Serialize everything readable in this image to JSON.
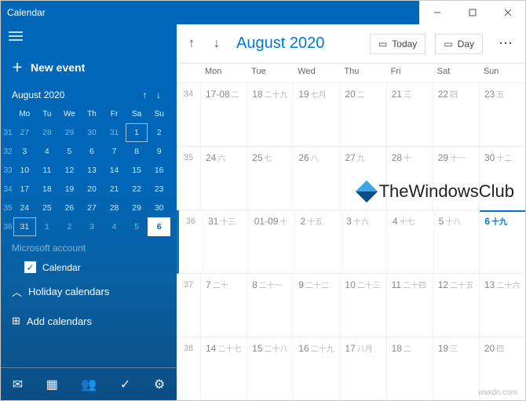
{
  "titlebar": {
    "title": "Calendar"
  },
  "sidebar": {
    "new_event": "New event",
    "mini_title": "August 2020",
    "dow": [
      "Mo",
      "Tu",
      "We",
      "Th",
      "Fr",
      "Sa",
      "Su"
    ],
    "weeks": [
      {
        "num": "31",
        "days": [
          {
            "t": "27",
            "ot": true
          },
          {
            "t": "28",
            "ot": true
          },
          {
            "t": "29",
            "ot": true
          },
          {
            "t": "30",
            "ot": true
          },
          {
            "t": "31",
            "ot": true
          },
          {
            "t": "1",
            "box": true
          },
          {
            "t": "2"
          }
        ]
      },
      {
        "num": "32",
        "days": [
          {
            "t": "3"
          },
          {
            "t": "4"
          },
          {
            "t": "5"
          },
          {
            "t": "6"
          },
          {
            "t": "7"
          },
          {
            "t": "8"
          },
          {
            "t": "9"
          }
        ]
      },
      {
        "num": "33",
        "days": [
          {
            "t": "10"
          },
          {
            "t": "11"
          },
          {
            "t": "12"
          },
          {
            "t": "13"
          },
          {
            "t": "14"
          },
          {
            "t": "15"
          },
          {
            "t": "16"
          }
        ]
      },
      {
        "num": "34",
        "days": [
          {
            "t": "17"
          },
          {
            "t": "18"
          },
          {
            "t": "19"
          },
          {
            "t": "20"
          },
          {
            "t": "21"
          },
          {
            "t": "22"
          },
          {
            "t": "23"
          }
        ]
      },
      {
        "num": "35",
        "days": [
          {
            "t": "24"
          },
          {
            "t": "25"
          },
          {
            "t": "26"
          },
          {
            "t": "27"
          },
          {
            "t": "28"
          },
          {
            "t": "29"
          },
          {
            "t": "30"
          }
        ]
      },
      {
        "num": "36",
        "days": [
          {
            "t": "31",
            "box": true
          },
          {
            "t": "1",
            "ot": true
          },
          {
            "t": "2",
            "ot": true
          },
          {
            "t": "3",
            "ot": true
          },
          {
            "t": "4",
            "ot": true
          },
          {
            "t": "5",
            "ot": true
          },
          {
            "t": "6",
            "sel": true
          }
        ]
      }
    ],
    "account_label": "Microsoft account",
    "calendar_check": "Calendar",
    "holiday": "Holiday calendars",
    "add": "Add calendars"
  },
  "main": {
    "title": "August 2020",
    "today_btn": "Today",
    "day_btn": "Day",
    "dow": [
      "Mon",
      "Tue",
      "Wed",
      "Thu",
      "Fri",
      "Sat",
      "Sun"
    ],
    "rows": [
      {
        "num": "34",
        "cells": [
          {
            "d": "17-08",
            "s": "二"
          },
          {
            "d": "18",
            "s": "二十九"
          },
          {
            "d": "19",
            "s": "七月"
          },
          {
            "d": "20",
            "s": "二"
          },
          {
            "d": "21",
            "s": "三"
          },
          {
            "d": "22",
            "s": "四"
          },
          {
            "d": "23",
            "s": "五"
          }
        ]
      },
      {
        "num": "35",
        "cells": [
          {
            "d": "24",
            "s": "六"
          },
          {
            "d": "25",
            "s": "七"
          },
          {
            "d": "26",
            "s": "八"
          },
          {
            "d": "27",
            "s": "九"
          },
          {
            "d": "28",
            "s": "十"
          },
          {
            "d": "29",
            "s": "十一"
          },
          {
            "d": "30",
            "s": "十二"
          }
        ]
      },
      {
        "num": "36",
        "today": true,
        "cells": [
          {
            "d": "31",
            "s": "十三"
          },
          {
            "d": "01-09",
            "s": "十"
          },
          {
            "d": "2",
            "s": "十五"
          },
          {
            "d": "3",
            "s": "十六"
          },
          {
            "d": "4",
            "s": "十七"
          },
          {
            "d": "5",
            "s": "十八"
          },
          {
            "d": "6",
            "s": "十九",
            "today": true
          }
        ]
      },
      {
        "num": "37",
        "cells": [
          {
            "d": "7",
            "s": "二十"
          },
          {
            "d": "8",
            "s": "二十一"
          },
          {
            "d": "9",
            "s": "二十二"
          },
          {
            "d": "10",
            "s": "二十三"
          },
          {
            "d": "11",
            "s": "二十四"
          },
          {
            "d": "12",
            "s": "二十五"
          },
          {
            "d": "13",
            "s": "二十六"
          }
        ]
      },
      {
        "num": "38",
        "cells": [
          {
            "d": "14",
            "s": "二十七"
          },
          {
            "d": "15",
            "s": "二十八"
          },
          {
            "d": "16",
            "s": "二十九"
          },
          {
            "d": "17",
            "s": "八月"
          },
          {
            "d": "18",
            "s": "二"
          },
          {
            "d": "19",
            "s": "三"
          },
          {
            "d": "20",
            "s": "四"
          }
        ]
      }
    ]
  },
  "watermark": "TheWindowsClub",
  "credit": "wsxdn.com"
}
